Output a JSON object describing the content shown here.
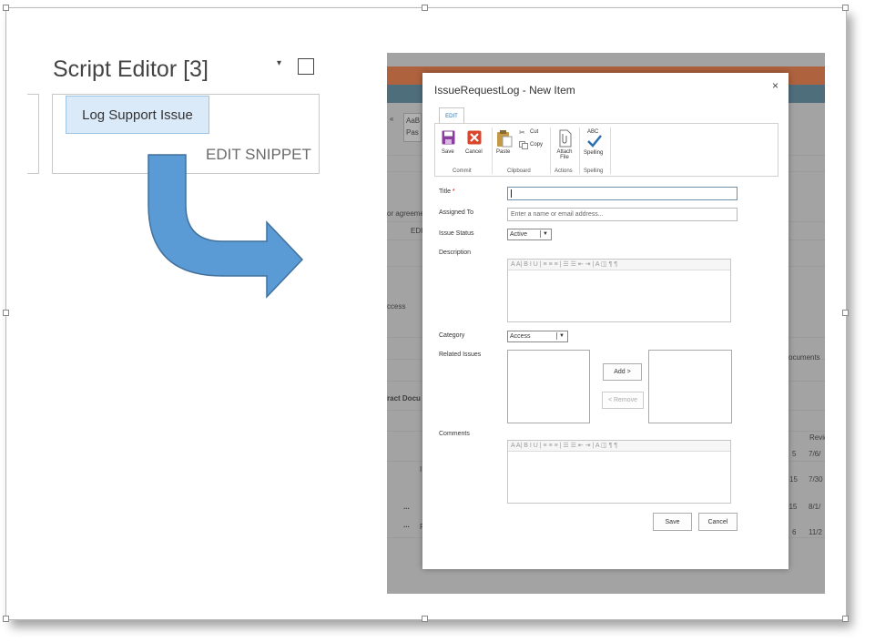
{
  "webpart": {
    "title": "Script Editor [3]",
    "menu_glyph": "▾",
    "button_label": "Log Support Issue",
    "edit_snippet_label": "EDIT SNIPPET"
  },
  "colors": {
    "arrow_fill": "#5b9bd5",
    "arrow_stroke": "#41719c",
    "button_bg": "#dbeaf9",
    "top_bar_orange": "#ae623e",
    "top_bar_teal": "#4f6e7c"
  },
  "background_page": {
    "fragments": [
      "«",
      "AaB",
      "Pas",
      "or agreeme",
      "EDI",
      "ccess",
      "ract Docu",
      "ocuments",
      "Revie",
      "5",
      "7/6/",
      "15",
      "7/30",
      "015",
      "8/1/",
      "6",
      "11/2",
      "...",
      "...",
      "I",
      "F"
    ]
  },
  "dialog": {
    "title": "IssueRequestLog - New Item",
    "close_glyph": "×",
    "ribbon": {
      "tab": "EDIT",
      "buttons": {
        "save": "Save",
        "cancel": "Cancel",
        "paste": "Paste",
        "cut": "Cut",
        "copy": "Copy",
        "attach": "Attach File",
        "spelling_abc": "ABC",
        "spelling": "Spelling"
      },
      "groups": {
        "commit": "Commit",
        "clipboard": "Clipboard",
        "actions": "Actions",
        "spelling": "Spelling"
      }
    },
    "form": {
      "title_label": "Title",
      "required_mark": "*",
      "assigned_label": "Assigned To",
      "assigned_placeholder": "Enter a name or email address...",
      "status_label": "Issue Status",
      "status_value": "Active",
      "description_label": "Description",
      "rte_toolbar": "A  A|  B  I  U  |  ≡  ≡  ≡  |  ☰  ☰  ⇤  ⇥  |  A  ◫  ¶  ¶",
      "category_label": "Category",
      "category_value": "Access",
      "related_label": "Related Issues",
      "add_label": "Add >",
      "remove_label": "< Remove",
      "comments_label": "Comments",
      "save_label": "Save",
      "cancel_label": "Cancel"
    }
  }
}
